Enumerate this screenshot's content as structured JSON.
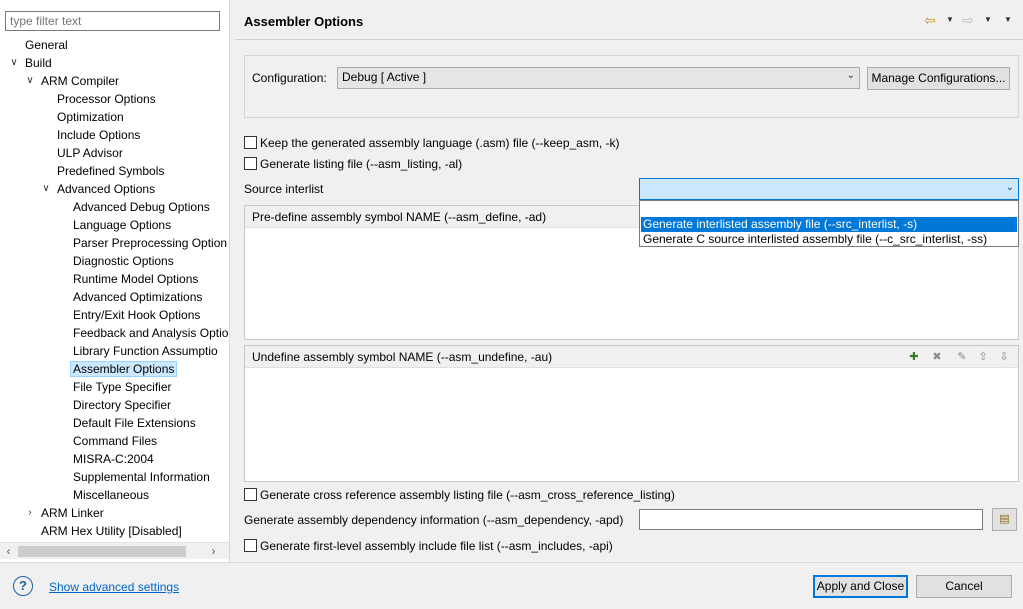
{
  "filter": {
    "placeholder": "type filter text"
  },
  "tree": [
    {
      "label": "General",
      "level": 0,
      "twisty": ""
    },
    {
      "label": "Build",
      "level": 0,
      "twisty": "open"
    },
    {
      "label": "ARM Compiler",
      "level": 1,
      "twisty": "open"
    },
    {
      "label": "Processor Options",
      "level": 2,
      "twisty": ""
    },
    {
      "label": "Optimization",
      "level": 2,
      "twisty": ""
    },
    {
      "label": "Include Options",
      "level": 2,
      "twisty": ""
    },
    {
      "label": "ULP Advisor",
      "level": 2,
      "twisty": ""
    },
    {
      "label": "Predefined Symbols",
      "level": 2,
      "twisty": ""
    },
    {
      "label": "Advanced Options",
      "level": 2,
      "twisty": "open"
    },
    {
      "label": "Advanced Debug Options",
      "level": 3,
      "twisty": ""
    },
    {
      "label": "Language Options",
      "level": 3,
      "twisty": ""
    },
    {
      "label": "Parser Preprocessing Option",
      "level": 3,
      "twisty": ""
    },
    {
      "label": "Diagnostic Options",
      "level": 3,
      "twisty": ""
    },
    {
      "label": "Runtime Model Options",
      "level": 3,
      "twisty": ""
    },
    {
      "label": "Advanced Optimizations",
      "level": 3,
      "twisty": ""
    },
    {
      "label": "Entry/Exit Hook Options",
      "level": 3,
      "twisty": ""
    },
    {
      "label": "Feedback and Analysis Optio",
      "level": 3,
      "twisty": ""
    },
    {
      "label": "Library Function Assumptio",
      "level": 3,
      "twisty": ""
    },
    {
      "label": "Assembler Options",
      "level": 3,
      "twisty": "",
      "selected": true
    },
    {
      "label": "File Type Specifier",
      "level": 3,
      "twisty": ""
    },
    {
      "label": "Directory Specifier",
      "level": 3,
      "twisty": ""
    },
    {
      "label": "Default File Extensions",
      "level": 3,
      "twisty": ""
    },
    {
      "label": "Command Files",
      "level": 3,
      "twisty": ""
    },
    {
      "label": "MISRA-C:2004",
      "level": 3,
      "twisty": ""
    },
    {
      "label": "Supplemental Information",
      "level": 3,
      "twisty": ""
    },
    {
      "label": "Miscellaneous",
      "level": 3,
      "twisty": ""
    },
    {
      "label": "ARM Linker",
      "level": 1,
      "twisty": "closed"
    },
    {
      "label": "ARM Hex Utility  [Disabled]",
      "level": 1,
      "twisty": ""
    }
  ],
  "page": {
    "title": "Assembler Options"
  },
  "config": {
    "label": "Configuration:",
    "value": "Debug  [ Active ]",
    "manage_label": "Manage Configurations..."
  },
  "options": {
    "keep_asm": "Keep the generated assembly language (.asm) file (--keep_asm, -k)",
    "asm_listing": "Generate listing file (--asm_listing, -al)",
    "source_interlist_label": "Source interlist",
    "source_interlist_options": [
      "",
      "Generate interlisted assembly file (--src_interlist, -s)",
      "Generate C source interlisted assembly file (--c_src_interlist, -ss)"
    ],
    "predefine_header": "Pre-define assembly symbol NAME (--asm_define, -ad)",
    "undefine_header": "Undefine assembly symbol NAME (--asm_undefine, -au)",
    "cross_ref": "Generate cross reference assembly listing file (--asm_cross_reference_listing)",
    "dependency_label": "Generate assembly dependency information (--asm_dependency, -apd)",
    "dependency_value": "",
    "includes": "Generate first-level assembly include file list (--asm_includes, -api)"
  },
  "footer": {
    "advanced_link": "Show advanced settings",
    "apply_label": "Apply and Close",
    "cancel_label": "Cancel"
  },
  "colors": {
    "selection": "#0078d7",
    "tree_selected": "#cce8ff",
    "link": "#0066cc"
  }
}
